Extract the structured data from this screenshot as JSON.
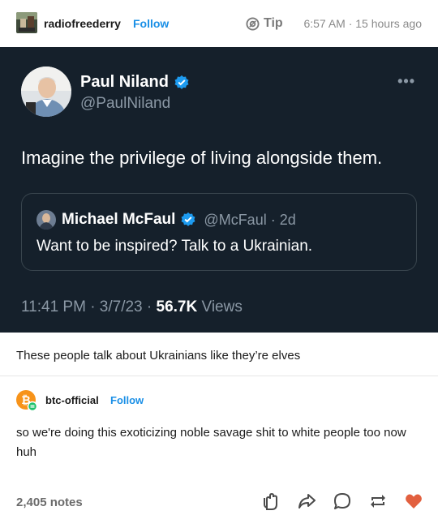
{
  "post": {
    "username": "radiofreederry",
    "follow_label": "Follow",
    "tip_label": "Tip",
    "timestamp": "6:57 AM · 15 hours ago"
  },
  "tweet": {
    "name": "Paul Niland",
    "handle": "@PaulNiland",
    "more_label": "•••",
    "text": "Imagine the privilege of living alongside them.",
    "quote": {
      "name": "Michael McFaul",
      "handle": "@McFaul · 2d",
      "text": "Want to be inspired? Talk to a Ukrainian."
    },
    "meta_time": "11:41 PM · 3/7/23 · ",
    "views_count": "56.7K",
    "views_label": " Views"
  },
  "caption": "These people talk about Ukrainians like they’re elves",
  "reblog": {
    "username": "btc-official",
    "follow_label": "Follow",
    "text": "so we're doing this exoticizing noble savage shit to white people too now huh"
  },
  "footer": {
    "notes": "2,405 notes"
  },
  "colors": {
    "tumblr_blue": "#1a8fe6",
    "tweet_bg": "#15202b",
    "twitter_verified": "#1d9bf0",
    "like_heart": "#e2603f",
    "btc_orange": "#f7931a"
  },
  "icons": {
    "tip": "tip-icon",
    "verified": "verified-badge-icon",
    "more": "more-dots-icon",
    "actions": [
      "clap-icon",
      "share-icon",
      "reply-icon",
      "reblog-icon",
      "like-heart-icon"
    ]
  }
}
